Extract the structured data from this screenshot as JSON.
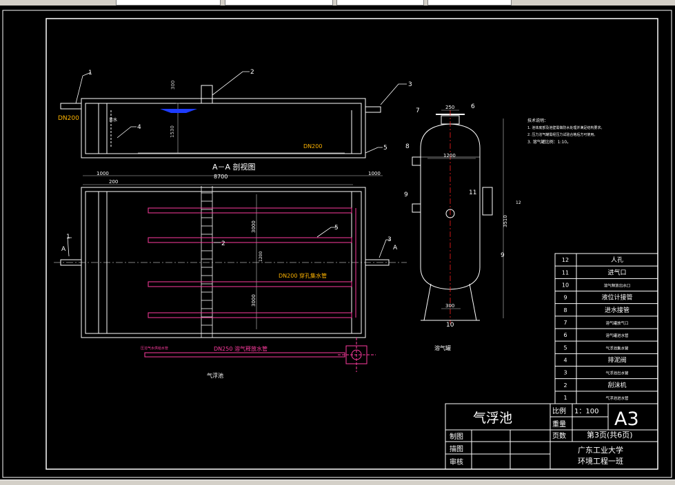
{
  "colors": {
    "background": "#000000",
    "line": "#ffffff",
    "pipe": "#ff3ca0",
    "dim": "#c8c8c8",
    "label": "#ffb400",
    "water": "#1e3cff",
    "axis": "#ff2020"
  },
  "section": {
    "title": "A－A 剖视图",
    "pipe_in_label": "DN200",
    "pipe_out_label": "DN200",
    "dim_300": "300",
    "dim_1530": "1530",
    "valve_label": "放水"
  },
  "plan": {
    "dims": [
      "1000",
      "200",
      "8700",
      "1000"
    ],
    "dim_3000_top": "3000",
    "dim_1200": "1200",
    "dim_3000_bottom": "3000",
    "pipe_label": "DN200 穿孔集水管",
    "pipe_250_label": "DN250 溶气释放水管",
    "left_pipe_label": "压溶气水供给水管",
    "title": "气浮池",
    "section_mark": "A"
  },
  "tank": {
    "dim_top": "250",
    "dim_width": "1200",
    "dim_height": "3510",
    "dim_base": "300",
    "title": "溶气罐",
    "notes_title": "技术说明：",
    "notes": [
      "1. 池体底部及池壁需做防水处理并满足结构要求。",
      "2. 压力溶气罐需经压力试验合格后方可使用。",
      "3. 溶气罐比例：1:10。"
    ]
  },
  "callouts": {
    "c1": "1",
    "c2": "2",
    "c3": "3",
    "c4": "4",
    "c5": "5",
    "c6": "6",
    "c7": "7",
    "c8": "8",
    "c9": "9",
    "c10": "10",
    "c11": "11",
    "c12": "12"
  },
  "parts": [
    {
      "no": "12",
      "name": "人孔"
    },
    {
      "no": "11",
      "name": "进气口"
    },
    {
      "no": "10",
      "name": "溶气释放出水口"
    },
    {
      "no": "9",
      "name": "液位计接管"
    },
    {
      "no": "8",
      "name": "进水接管"
    },
    {
      "no": "7",
      "name": "溶气罐放气口"
    },
    {
      "no": "6",
      "name": "溶气罐进水管"
    },
    {
      "no": "5",
      "name": "气浮池集水管"
    },
    {
      "no": "4",
      "name": "排泥阀"
    },
    {
      "no": "3",
      "name": "气浮池出水管"
    },
    {
      "no": "2",
      "name": "刮沫机"
    },
    {
      "no": "1",
      "name": "气浮池进水管"
    }
  ],
  "title_block": {
    "title": "气浮池",
    "scale_label": "比例",
    "scale_value": "1：100",
    "weight_label": "重量",
    "sheet_label": "页数",
    "sheet_value": "第3页(共6页)",
    "size": "A3",
    "drawn_label": "制图",
    "traced_label": "描图",
    "checked_label": "审核",
    "school": "广东工业大学",
    "class": "环境工程一班"
  }
}
